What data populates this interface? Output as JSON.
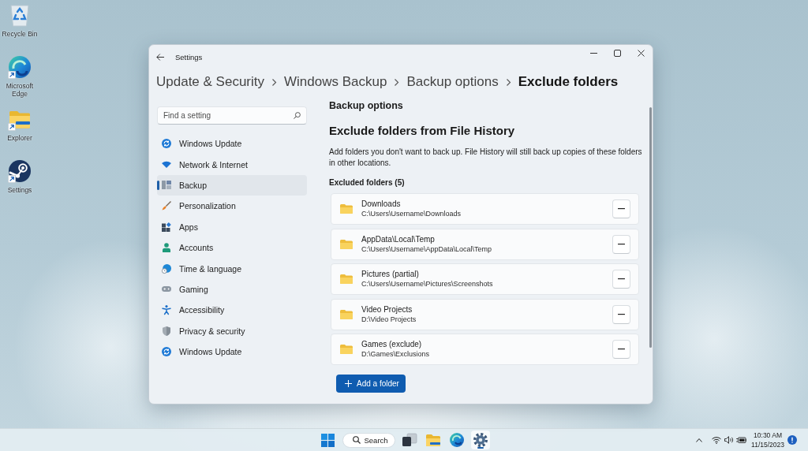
{
  "desktop": {
    "icons": [
      {
        "label": "Recycle Bin",
        "kind": "recycle-bin",
        "shortcut": false
      },
      {
        "label": "Microsoft Edge",
        "kind": "edge",
        "shortcut": true
      },
      {
        "label": "Explorer",
        "kind": "folder",
        "shortcut": true
      },
      {
        "label": "Settings",
        "kind": "disc",
        "shortcut": true
      }
    ]
  },
  "window": {
    "title": "Settings",
    "breadcrumb": [
      {
        "label": "Update & Security",
        "current": false
      },
      {
        "label": "Windows Backup",
        "current": false
      },
      {
        "label": "Backup options",
        "current": false
      },
      {
        "label": "Exclude folders",
        "current": true
      }
    ]
  },
  "sidebar": {
    "search": {
      "placeholder": "Find a setting"
    },
    "items": [
      {
        "label": "Windows Update",
        "kind": "update",
        "selected": false
      },
      {
        "label": "Network & Internet",
        "kind": "network",
        "selected": false
      },
      {
        "label": "Backup",
        "kind": "backup",
        "selected": true
      },
      {
        "label": "Personalization",
        "kind": "personalization",
        "selected": false
      },
      {
        "label": "Apps",
        "kind": "apps",
        "selected": false
      },
      {
        "label": "Accounts",
        "kind": "accounts",
        "selected": false
      },
      {
        "label": "Time & language",
        "kind": "time",
        "selected": false
      },
      {
        "label": "Gaming",
        "kind": "gaming",
        "selected": false
      },
      {
        "label": "Accessibility",
        "kind": "accessibility",
        "selected": false
      },
      {
        "label": "Privacy & security",
        "kind": "privacy",
        "selected": false
      },
      {
        "label": "Windows Update",
        "kind": "update",
        "selected": false
      }
    ]
  },
  "content": {
    "section": "Backup options",
    "heading": "Exclude folders from File History",
    "description": "Add folders you don't want to back up. File History will still back up copies of these folders in other locations.",
    "list_label": "Excluded folders (5)",
    "folders": [
      {
        "name": "Downloads",
        "path": "C:\\Users\\Username\\Downloads"
      },
      {
        "name": "AppData\\Local\\Temp",
        "path": "C:\\Users\\Username\\AppData\\Local\\Temp"
      },
      {
        "name": "Pictures (partial)",
        "path": "C:\\Users\\Username\\Pictures\\Screenshots"
      },
      {
        "name": "Video Projects",
        "path": "D:\\Video Projects"
      },
      {
        "name": "Games (exclude)",
        "path": "D:\\Games\\Exclusions"
      }
    ],
    "add_button": "Add a folder"
  },
  "taskbar": {
    "search": "Search",
    "apps": [
      {
        "kind": "task-view",
        "active": false
      },
      {
        "kind": "explorer",
        "active": false
      },
      {
        "kind": "edge",
        "active": false
      },
      {
        "kind": "settings",
        "active": true
      }
    ],
    "clock": {
      "time": "10:30 AM",
      "date": "11/15/2023"
    }
  }
}
